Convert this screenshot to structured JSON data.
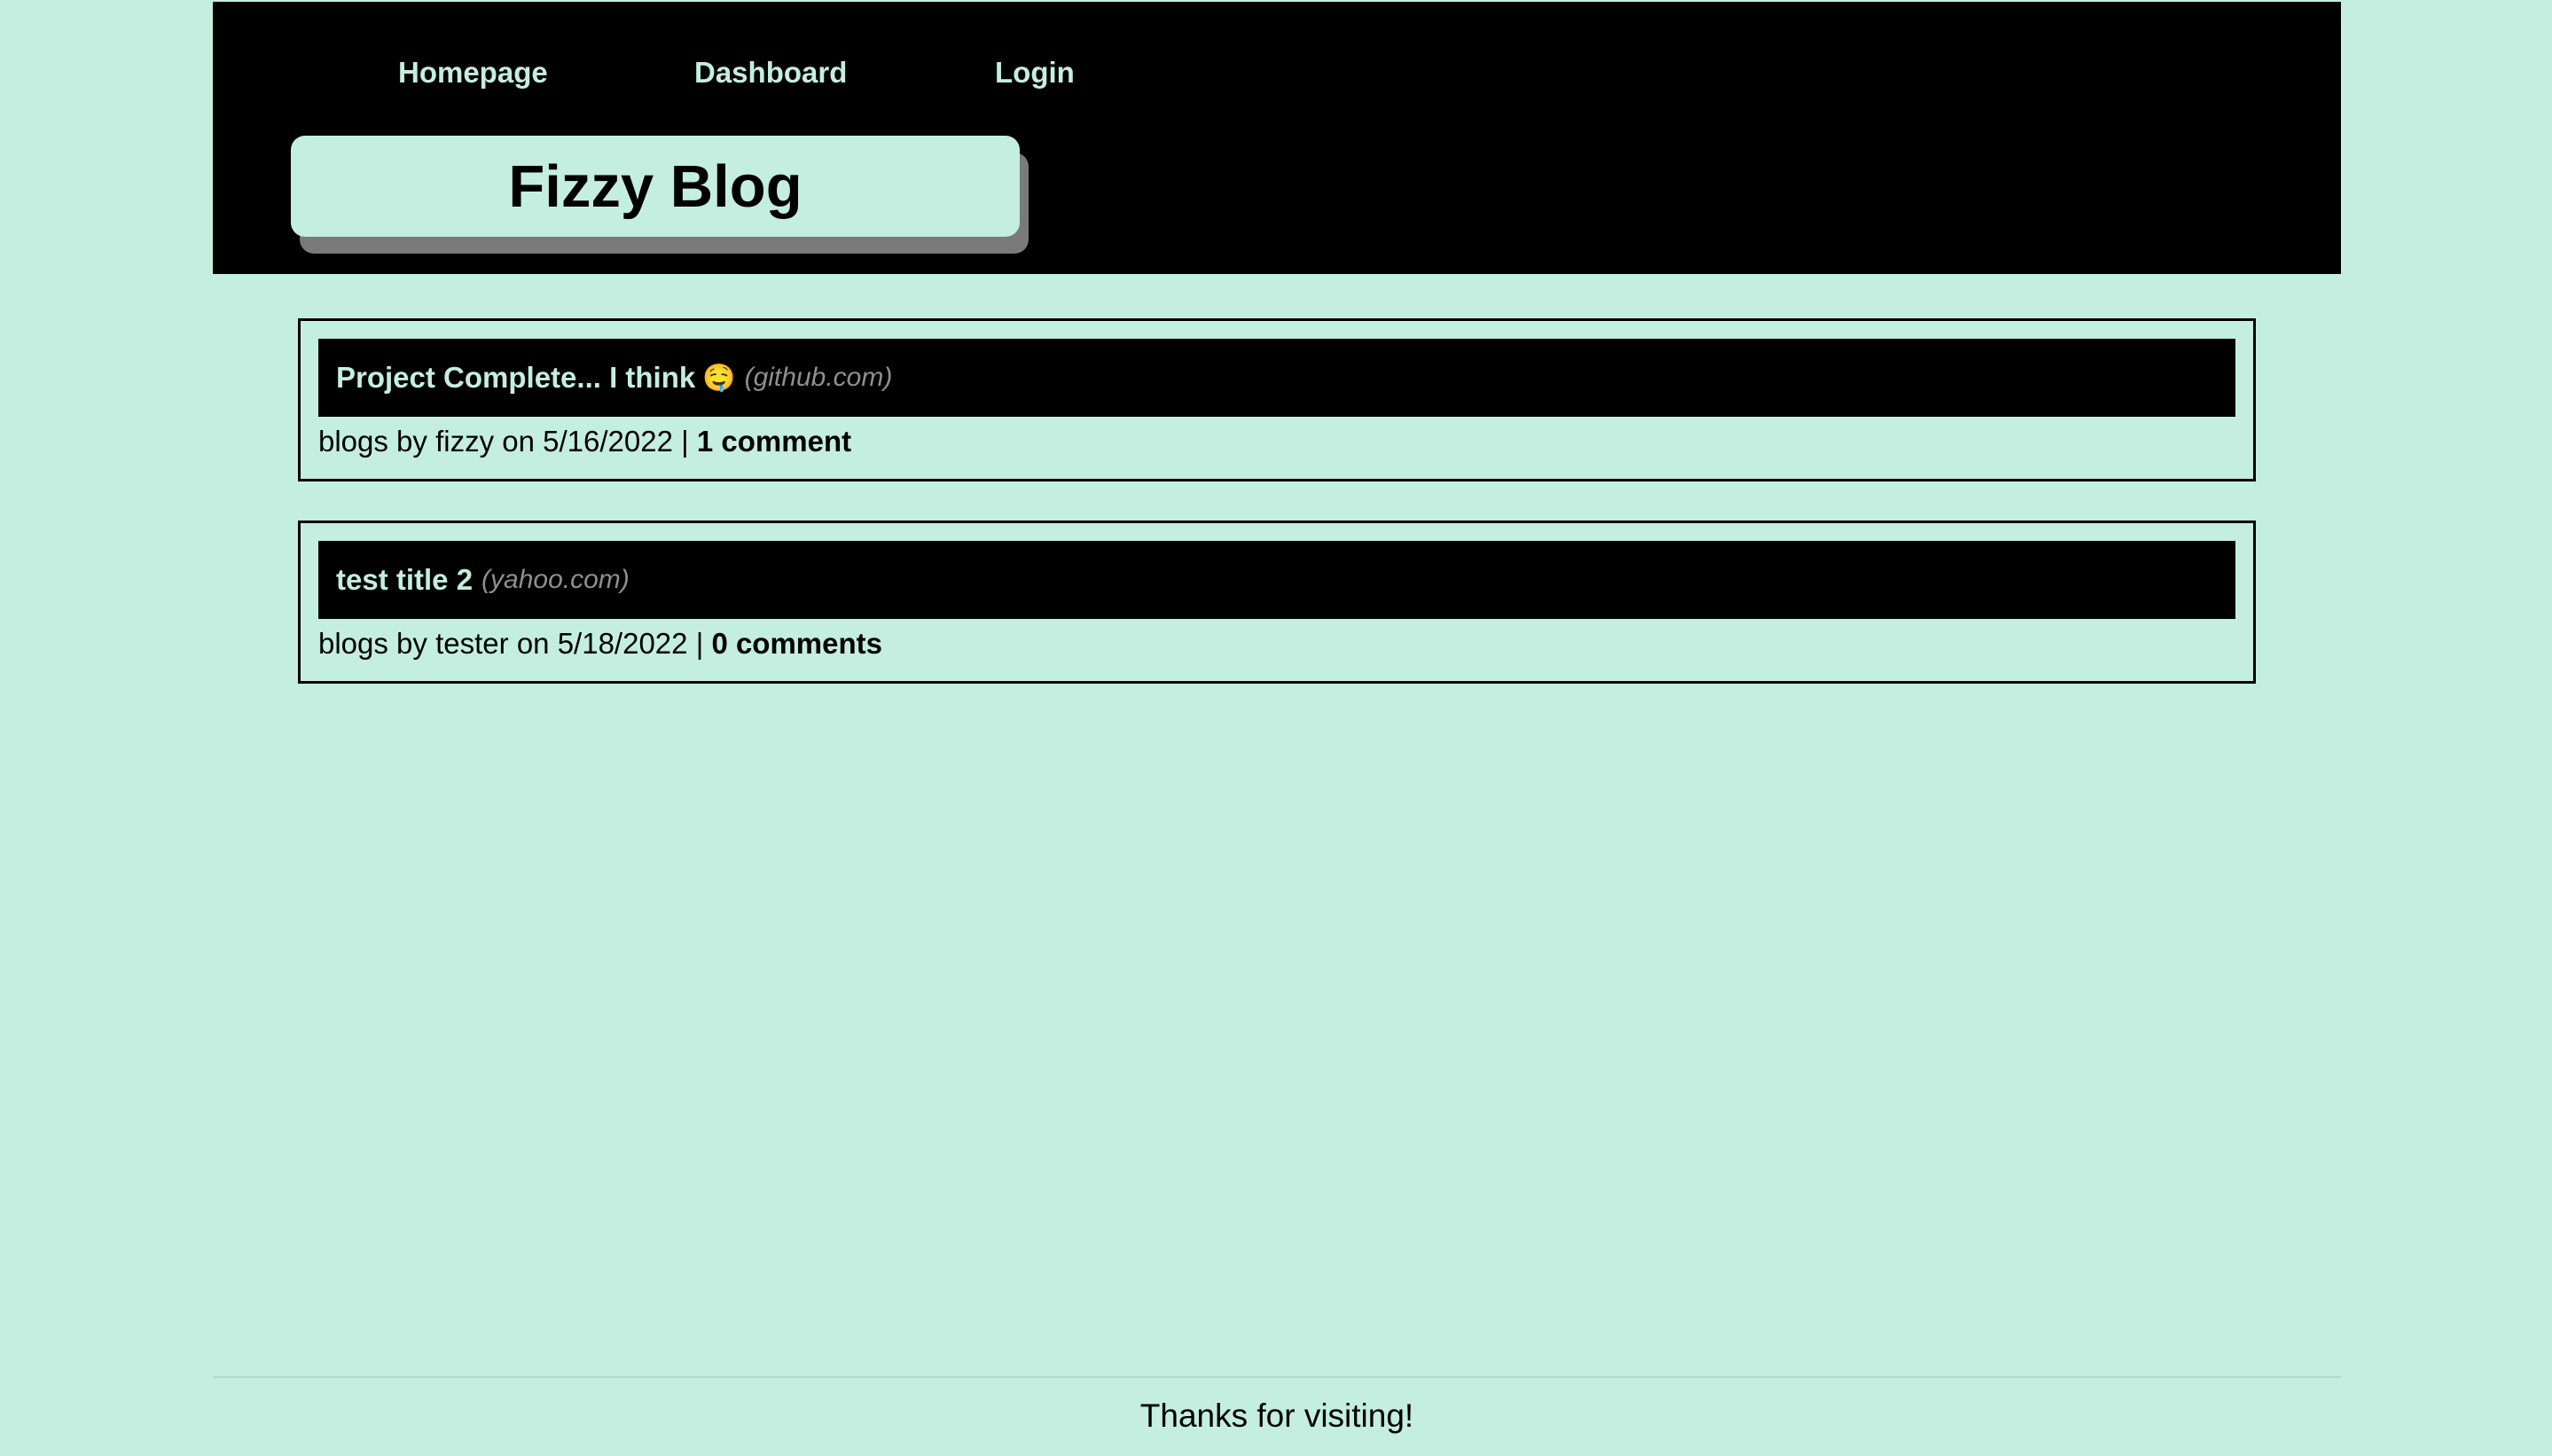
{
  "nav": {
    "homepage": "Homepage",
    "dashboard": "Dashboard",
    "login": "Login"
  },
  "header": {
    "title": "Fizzy Blog"
  },
  "posts": [
    {
      "title": "Project Complete... I think",
      "emoji": "🤤",
      "domain": "(github.com)",
      "meta_prefix": "blogs by",
      "author": "fizzy",
      "meta_on": "on",
      "date": "5/16/2022",
      "separator": "|",
      "comments": "1 comment"
    },
    {
      "title": "test title 2",
      "emoji": "",
      "domain": "(yahoo.com)",
      "meta_prefix": "blogs by",
      "author": "tester",
      "meta_on": "on",
      "date": "5/18/2022",
      "separator": "|",
      "comments": "0 comments"
    }
  ],
  "footer": {
    "text": "Thanks for visiting!"
  },
  "colors": {
    "background": "#c4eedf",
    "header": "#000000",
    "link": "#c4eedf",
    "domain": "#8f8f8f",
    "title_shadow": "#7a7a7a"
  }
}
